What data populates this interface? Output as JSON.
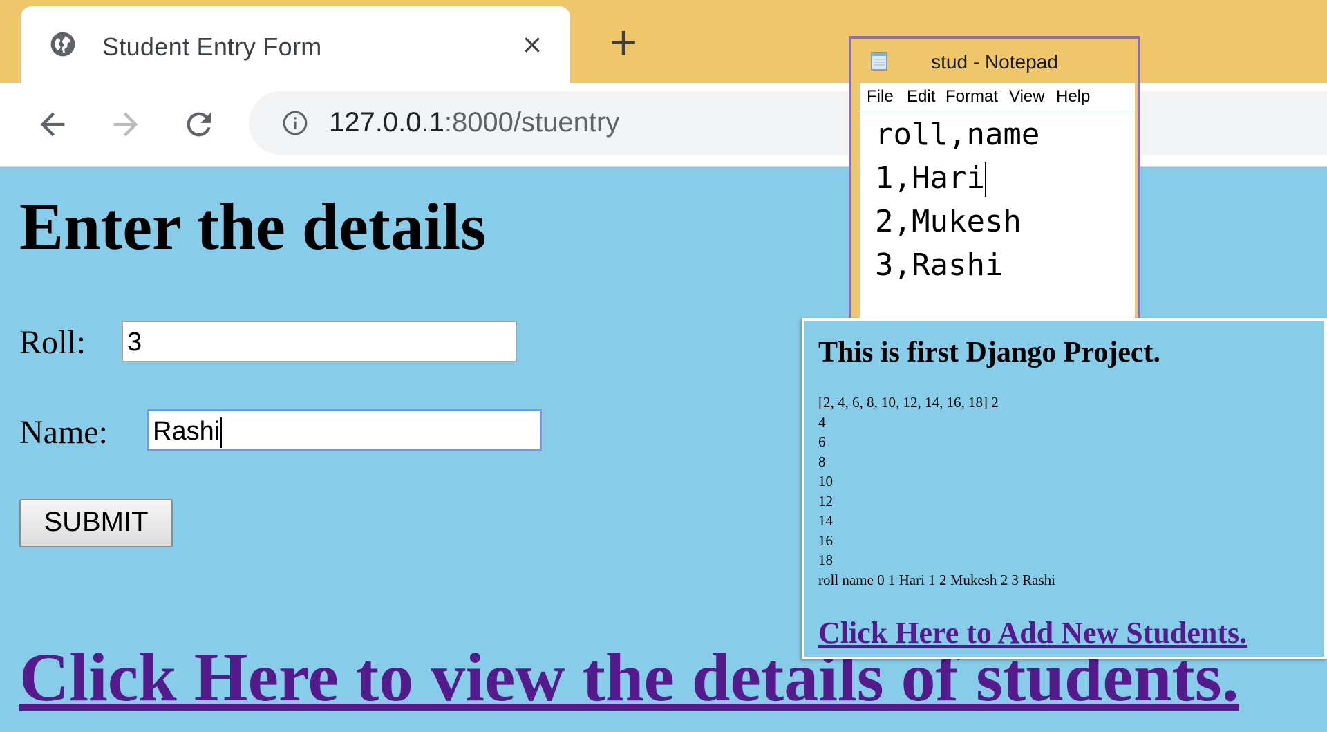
{
  "browser": {
    "tab_title": "Student Entry Form",
    "close_symbol": "×",
    "new_tab_symbol": "+",
    "url_host": "127.0.0.1",
    "url_rest": ":8000/stuentry",
    "icons": {
      "tab": "globe-icon",
      "back": "arrow-left-icon",
      "forward": "arrow-right-icon",
      "reload": "reload-icon",
      "info": "info-icon"
    },
    "colors": {
      "tab_strip": "#f0c66b",
      "toolbar": "#ffffff",
      "omnibox": "#f1f3f4"
    }
  },
  "form": {
    "heading": "Enter the details",
    "roll_label": "Roll:",
    "roll_value": "3",
    "name_label": "Name:",
    "name_value": "Rashi",
    "submit_label": "SUBMIT",
    "view_link": "Click Here to view the details of students.",
    "colors": {
      "page_background": "#87cde9",
      "link": "#551a8b"
    }
  },
  "notepad": {
    "title": "stud - Notepad",
    "menu": [
      "File",
      "Edit",
      "Format",
      "View",
      "Help"
    ],
    "lines": [
      "roll,name",
      "1,Hari",
      "2,Mukesh",
      "3,Rashi"
    ]
  },
  "popup": {
    "heading": "This is first Django Project.",
    "output_lines": [
      "[2, 4, 6, 8, 10, 12, 14, 16, 18] 2",
      "4",
      "6",
      "8",
      "10",
      "12",
      "14",
      "16",
      "18",
      "roll name 0 1 Hari 1 2 Mukesh 2 3 Rashi"
    ],
    "link": "Click Here to Add New Students."
  }
}
